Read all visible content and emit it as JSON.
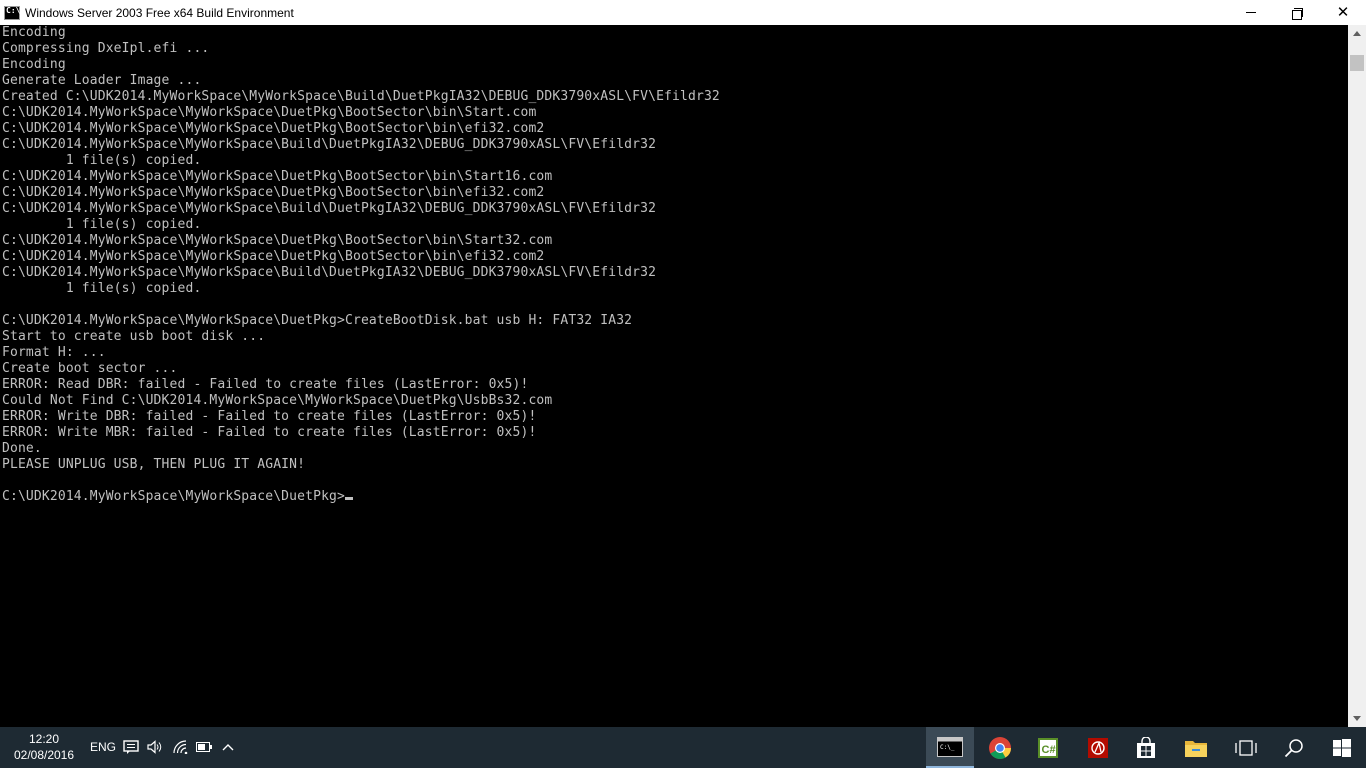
{
  "window": {
    "title": "Windows Server 2003 Free x64 Build Environment"
  },
  "console": {
    "lines": [
      "Encoding",
      "Compressing DxeIpl.efi ...",
      "Encoding",
      "Generate Loader Image ...",
      "Created C:\\UDK2014.MyWorkSpace\\MyWorkSpace\\Build\\DuetPkgIA32\\DEBUG_DDK3790xASL\\FV\\Efildr32",
      "C:\\UDK2014.MyWorkSpace\\MyWorkSpace\\DuetPkg\\BootSector\\bin\\Start.com",
      "C:\\UDK2014.MyWorkSpace\\MyWorkSpace\\DuetPkg\\BootSector\\bin\\efi32.com2",
      "C:\\UDK2014.MyWorkSpace\\MyWorkSpace\\Build\\DuetPkgIA32\\DEBUG_DDK3790xASL\\FV\\Efildr32",
      "        1 file(s) copied.",
      "C:\\UDK2014.MyWorkSpace\\MyWorkSpace\\DuetPkg\\BootSector\\bin\\Start16.com",
      "C:\\UDK2014.MyWorkSpace\\MyWorkSpace\\DuetPkg\\BootSector\\bin\\efi32.com2",
      "C:\\UDK2014.MyWorkSpace\\MyWorkSpace\\Build\\DuetPkgIA32\\DEBUG_DDK3790xASL\\FV\\Efildr32",
      "        1 file(s) copied.",
      "C:\\UDK2014.MyWorkSpace\\MyWorkSpace\\DuetPkg\\BootSector\\bin\\Start32.com",
      "C:\\UDK2014.MyWorkSpace\\MyWorkSpace\\DuetPkg\\BootSector\\bin\\efi32.com2",
      "C:\\UDK2014.MyWorkSpace\\MyWorkSpace\\Build\\DuetPkgIA32\\DEBUG_DDK3790xASL\\FV\\Efildr32",
      "        1 file(s) copied.",
      "",
      "C:\\UDK2014.MyWorkSpace\\MyWorkSpace\\DuetPkg>CreateBootDisk.bat usb H: FAT32 IA32",
      "Start to create usb boot disk ...",
      "Format H: ...",
      "Create boot sector ...",
      "ERROR: Read DBR: failed - Failed to create files (LastError: 0x5)!",
      "Could Not Find C:\\UDK2014.MyWorkSpace\\MyWorkSpace\\DuetPkg\\UsbBs32.com",
      "ERROR: Write DBR: failed - Failed to create files (LastError: 0x5)!",
      "ERROR: Write MBR: failed - Failed to create files (LastError: 0x5)!",
      "Done.",
      "PLEASE UNPLUG USB, THEN PLUG IT AGAIN!",
      ""
    ],
    "prompt": "C:\\UDK2014.MyWorkSpace\\MyWorkSpace\\DuetPkg>"
  },
  "taskbar": {
    "time": "12:20",
    "date": "02/08/2016",
    "language": "ENG",
    "tray_icons": [
      "action-center-icon",
      "volume-icon",
      "network-icon",
      "battery-icon",
      "show-hidden-icons-icon"
    ],
    "apps": [
      "command-prompt-icon",
      "chrome-icon",
      "visual-studio-icon",
      "acrobat-icon",
      "store-icon",
      "file-explorer-icon",
      "task-view-icon",
      "search-icon",
      "start-icon"
    ]
  },
  "colors": {
    "console_text": "#c0c0c0",
    "console_bg": "#000000",
    "taskbar_bg": "#1e2a33",
    "accent": "#8fb6dc"
  }
}
